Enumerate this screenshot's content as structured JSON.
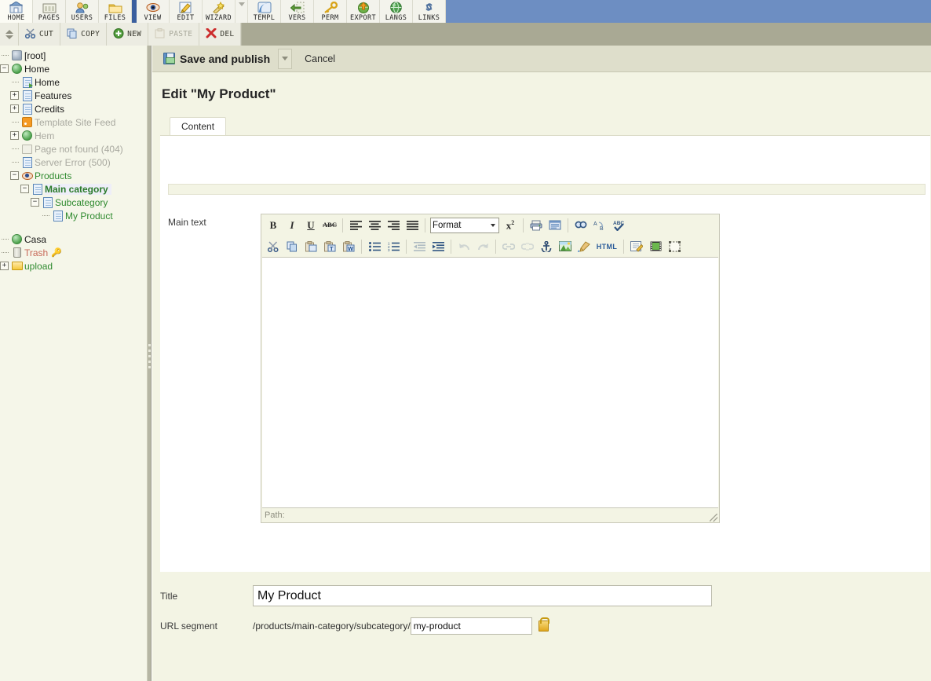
{
  "topnav": {
    "items": [
      {
        "label": "HOME",
        "icon": "home-icon"
      },
      {
        "label": "PAGES",
        "icon": "pages-icon"
      },
      {
        "label": "USERS",
        "icon": "users-icon"
      },
      {
        "label": "FILES",
        "icon": "files-icon"
      },
      {
        "label": "VIEW",
        "icon": "eye-icon"
      },
      {
        "label": "EDIT",
        "icon": "pencil-icon"
      },
      {
        "label": "WIZARD",
        "icon": "wand-icon"
      },
      {
        "label": "TEMPL",
        "icon": "template-icon"
      },
      {
        "label": "VERS",
        "icon": "versions-icon"
      },
      {
        "label": "PERM",
        "icon": "key-icon"
      },
      {
        "label": "EXPORT",
        "icon": "export-icon"
      },
      {
        "label": "LANGS",
        "icon": "globe-icon"
      },
      {
        "label": "LINKS",
        "icon": "links-icon"
      }
    ],
    "bg_color": "#6d8ec2",
    "separator_color": "#3a5f9e"
  },
  "toolbar2": {
    "bg_color": "#a9a994",
    "buttons": [
      {
        "label": "CUT",
        "icon": "scissors-icon",
        "disabled": false
      },
      {
        "label": "COPY",
        "icon": "copy-icon",
        "disabled": false
      },
      {
        "label": "NEW",
        "icon": "new-icon",
        "disabled": false
      },
      {
        "label": "PASTE",
        "icon": "paste-icon",
        "disabled": true
      },
      {
        "label": "DEL",
        "icon": "delete-icon",
        "disabled": false
      }
    ]
  },
  "sidebar": {
    "bg_color": "#f5f6e9",
    "nodes": [
      {
        "label": "[root]",
        "indent": 0,
        "toggle": "none",
        "icon": "root-icon",
        "color": "dark",
        "selected": false
      },
      {
        "label": "Home",
        "indent": 0,
        "toggle": "minus",
        "icon": "globe-icon",
        "color": "dark",
        "selected": false
      },
      {
        "label": "Home",
        "indent": 1,
        "toggle": "none",
        "icon": "doc-arrow-icon",
        "color": "dark",
        "selected": false
      },
      {
        "label": "Features",
        "indent": 1,
        "toggle": "plus",
        "icon": "doc-icon",
        "color": "dark",
        "selected": false
      },
      {
        "label": "Credits",
        "indent": 1,
        "toggle": "plus",
        "icon": "doc-icon",
        "color": "dark",
        "selected": false
      },
      {
        "label": "Template Site Feed",
        "indent": 1,
        "toggle": "none",
        "icon": "rss-icon",
        "color": "grey",
        "selected": false
      },
      {
        "label": "Hem",
        "indent": 1,
        "toggle": "plus",
        "icon": "globe-icon",
        "color": "grey",
        "selected": false
      },
      {
        "label": "Page not found (404)",
        "indent": 1,
        "toggle": "none",
        "icon": "notfound-icon",
        "color": "grey",
        "selected": false
      },
      {
        "label": "Server Error (500)",
        "indent": 1,
        "toggle": "none",
        "icon": "doc-icon",
        "color": "grey",
        "selected": false
      },
      {
        "label": "Products",
        "indent": 1,
        "toggle": "minus",
        "icon": "eye-icon",
        "color": "green",
        "selected": false
      },
      {
        "label": "Main category",
        "indent": 2,
        "toggle": "minus",
        "icon": "doc-icon",
        "color": "green",
        "selected": true
      },
      {
        "label": "Subcategory",
        "indent": 3,
        "toggle": "minus",
        "icon": "doc-icon",
        "color": "green",
        "selected": false
      },
      {
        "label": "My Product",
        "indent": 4,
        "toggle": "none",
        "icon": "doc-icon",
        "color": "green",
        "selected": false
      },
      {
        "label": "Casa",
        "indent": 0,
        "toggle": "none",
        "icon": "globe-icon",
        "color": "dark",
        "selected": false
      },
      {
        "label": "Trash",
        "indent": 0,
        "toggle": "none",
        "icon": "trash-icon",
        "color": "red",
        "selected": false,
        "suffix_icon": "key-icon"
      },
      {
        "label": "upload",
        "indent": 0,
        "toggle": "plus",
        "icon": "folder-icon",
        "color": "green",
        "selected": false
      }
    ]
  },
  "actionbar": {
    "save_label": "Save and publish",
    "save_icon": "floppy-icon",
    "dropdown_icon": "chevron-down-icon",
    "cancel_label": "Cancel"
  },
  "page": {
    "title": "Edit \"My Product\""
  },
  "tabs": [
    {
      "label": "Content",
      "active": true
    }
  ],
  "editor": {
    "field_label": "Main text",
    "format_value": "Format",
    "status_label": "Path:",
    "toolbar_row1": [
      {
        "name": "bold-icon",
        "glyph": "B",
        "kind": "bold",
        "disabled": false
      },
      {
        "name": "italic-icon",
        "glyph": "I",
        "kind": "italic",
        "disabled": false
      },
      {
        "name": "underline-icon",
        "glyph": "U",
        "kind": "under",
        "disabled": false
      },
      {
        "name": "strikethrough-icon",
        "glyph": "ABC",
        "kind": "strike",
        "disabled": false
      },
      {
        "name": "separator",
        "glyph": "",
        "kind": "sep",
        "disabled": false
      },
      {
        "name": "align-left-icon",
        "glyph": "▤",
        "kind": "alignl",
        "disabled": false
      },
      {
        "name": "align-center-icon",
        "glyph": "▤",
        "kind": "alignc",
        "disabled": false
      },
      {
        "name": "align-right-icon",
        "glyph": "▤",
        "kind": "alignr",
        "disabled": false
      },
      {
        "name": "align-justify-icon",
        "glyph": "▤",
        "kind": "alignj",
        "disabled": false
      },
      {
        "name": "separator",
        "glyph": "",
        "kind": "sep",
        "disabled": false
      },
      {
        "name": "format-select",
        "glyph": "",
        "kind": "select",
        "disabled": false
      },
      {
        "name": "superscript-icon",
        "glyph": "x²",
        "kind": "sup",
        "disabled": false
      },
      {
        "name": "separator",
        "glyph": "",
        "kind": "sep",
        "disabled": false
      },
      {
        "name": "print-icon",
        "glyph": "🖨",
        "kind": "print",
        "disabled": false
      },
      {
        "name": "preview-icon",
        "glyph": "▣",
        "kind": "preview",
        "disabled": false
      },
      {
        "name": "separator",
        "glyph": "",
        "kind": "sep",
        "disabled": false
      },
      {
        "name": "search-icon",
        "glyph": "🔍",
        "kind": "find",
        "disabled": false
      },
      {
        "name": "replace-icon",
        "glyph": "⇄",
        "kind": "replace",
        "disabled": false
      },
      {
        "name": "spellcheck-icon",
        "glyph": "✓",
        "kind": "spell",
        "disabled": false
      }
    ],
    "toolbar_row2": [
      {
        "name": "cut-icon",
        "glyph": "✂",
        "kind": "cut",
        "disabled": false
      },
      {
        "name": "copy-icon",
        "glyph": "⧉",
        "kind": "copy",
        "disabled": false
      },
      {
        "name": "paste-icon",
        "glyph": "📋",
        "kind": "paste",
        "disabled": false
      },
      {
        "name": "paste-text-icon",
        "glyph": "T",
        "kind": "pastet",
        "disabled": false
      },
      {
        "name": "paste-word-icon",
        "glyph": "W",
        "kind": "pastew",
        "disabled": false
      },
      {
        "name": "separator",
        "glyph": "",
        "kind": "sep",
        "disabled": false
      },
      {
        "name": "bullet-list-icon",
        "glyph": "☰",
        "kind": "ul",
        "disabled": false
      },
      {
        "name": "numbered-list-icon",
        "glyph": "☰",
        "kind": "ol",
        "disabled": false
      },
      {
        "name": "separator",
        "glyph": "",
        "kind": "sep",
        "disabled": false
      },
      {
        "name": "outdent-icon",
        "glyph": "⇤",
        "kind": "outd",
        "disabled": true
      },
      {
        "name": "indent-icon",
        "glyph": "⇥",
        "kind": "ind",
        "disabled": false
      },
      {
        "name": "separator",
        "glyph": "",
        "kind": "sep",
        "disabled": false
      },
      {
        "name": "undo-icon",
        "glyph": "↶",
        "kind": "undo",
        "disabled": true
      },
      {
        "name": "redo-icon",
        "glyph": "↷",
        "kind": "redo",
        "disabled": true
      },
      {
        "name": "separator",
        "glyph": "",
        "kind": "sep",
        "disabled": false
      },
      {
        "name": "link-icon",
        "glyph": "🔗",
        "kind": "link",
        "disabled": true
      },
      {
        "name": "unlink-icon",
        "glyph": "⛓",
        "kind": "unlink",
        "disabled": true
      },
      {
        "name": "anchor-icon",
        "glyph": "⚓",
        "kind": "anchor",
        "disabled": false
      },
      {
        "name": "image-icon",
        "glyph": "🖼",
        "kind": "image",
        "disabled": false
      },
      {
        "name": "cleanup-icon",
        "glyph": "🖌",
        "kind": "clean",
        "disabled": false
      },
      {
        "name": "html-source-icon",
        "glyph": "HTML",
        "kind": "html",
        "disabled": false
      },
      {
        "name": "separator",
        "glyph": "",
        "kind": "sep",
        "disabled": false
      },
      {
        "name": "edit-image-icon",
        "glyph": "✎",
        "kind": "editimg",
        "disabled": false
      },
      {
        "name": "media-icon",
        "glyph": "🎞",
        "kind": "media",
        "disabled": false
      },
      {
        "name": "fullscreen-icon",
        "glyph": "⛶",
        "kind": "full",
        "disabled": false
      }
    ]
  },
  "form": {
    "title_label": "Title",
    "title_value": "My Product",
    "url_label": "URL segment",
    "url_prefix": "/products/main-category/subcategory/",
    "url_value": "my-product",
    "lock_icon": "unlocked-padlock-icon"
  }
}
